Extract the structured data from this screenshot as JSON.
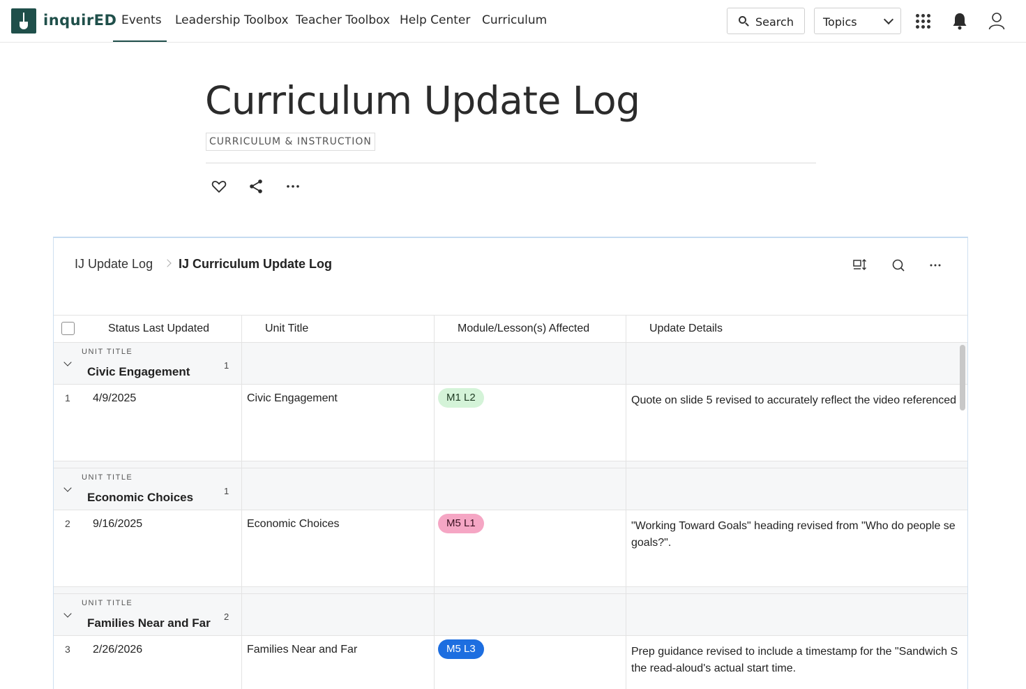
{
  "nav": {
    "brand": "inquirED",
    "items": [
      "Events",
      "Leadership Toolbox",
      "Teacher Toolbox",
      "Help Center",
      "Curriculum"
    ],
    "search_label": "Search",
    "topics_label": "Topics"
  },
  "header": {
    "title": "Curriculum Update Log",
    "category": "CURRICULUM & INSTRUCTION"
  },
  "embed": {
    "breadcrumb_root": "IJ Update Log",
    "breadcrumb_current": "IJ Curriculum Update Log",
    "columns": [
      "Status Last Updated",
      "Unit Title",
      "Module/Lesson(s) Affected",
      "Update Details"
    ],
    "groups": [
      {
        "label": "UNIT TITLE",
        "name": "Civic Engagement",
        "count": "1",
        "rows": [
          {
            "num": "1",
            "date": "4/9/2025",
            "unit": "Civic Engagement",
            "module": "M1 L2",
            "details_line1": "Quote on slide 5 revised to accurately reflect the video referenced",
            "details_line2": ""
          }
        ]
      },
      {
        "label": "UNIT TITLE",
        "name": "Economic Choices",
        "count": "1",
        "rows": [
          {
            "num": "2",
            "date": "9/16/2025",
            "unit": "Economic Choices",
            "module": "M5 L1",
            "details_line1": "\"Working Toward Goals\" heading revised from \"Who do people se",
            "details_line2": "goals?\"."
          }
        ]
      },
      {
        "label": "UNIT TITLE",
        "name": "Families Near and Far",
        "count": "2",
        "rows": [
          {
            "num": "3",
            "date": "2/26/2026",
            "unit": "Families Near and Far",
            "module": "M5 L3",
            "details_line1": "Prep guidance revised to include a timestamp for the \"Sandwich S",
            "details_line2": "the read-aloud's actual start time."
          }
        ]
      }
    ]
  },
  "colors": {
    "brand": "#1f4f4a",
    "pill_green_bg": "#d4f3d8",
    "pill_pink_bg": "#f5a6c4",
    "pill_blue_bg": "#1d6ee0"
  }
}
